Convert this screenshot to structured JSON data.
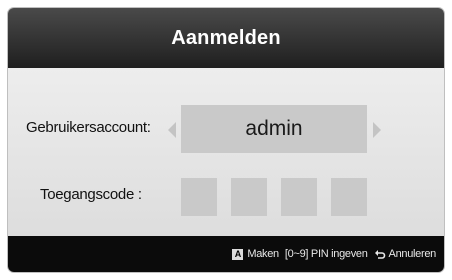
{
  "dialog": {
    "title": "Aanmelden"
  },
  "form": {
    "account_label": "Gebruikersaccount:",
    "account_value": "admin",
    "code_label": "Toegangscode :",
    "pin_boxes": 4
  },
  "footer": {
    "key_a": "A",
    "make_label": "Maken",
    "pin_hint": "[0~9] PIN ingeven",
    "cancel_label": "Annuleren"
  },
  "colors": {
    "header_bg": "#2a2a2a",
    "body_bg": "#e6e6e6",
    "field_bg": "#c9c9c9",
    "footer_bg": "#0b0b0b"
  },
  "icons": {
    "prev": "arrow-left-icon",
    "next": "arrow-right-icon",
    "return": "return-icon"
  }
}
